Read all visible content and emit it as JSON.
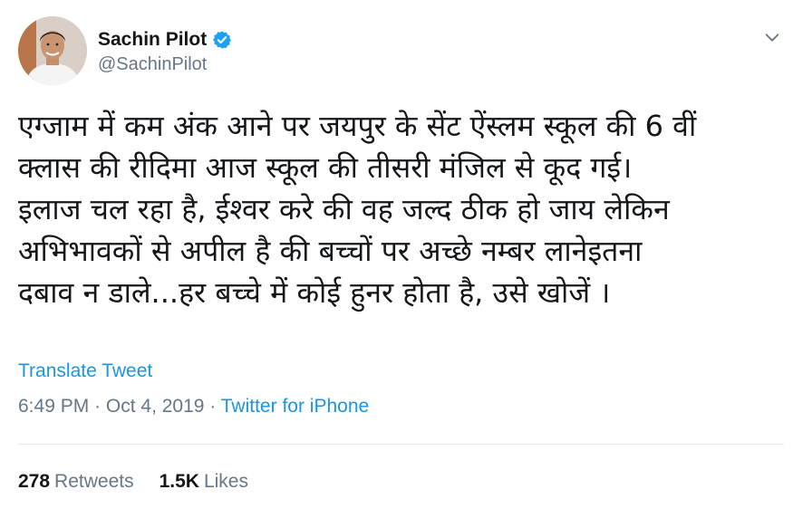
{
  "author": {
    "display_name": "Sachin Pilot",
    "handle": "@SachinPilot",
    "verified": true
  },
  "icons": {
    "verified": "verified-badge-icon",
    "menu": "chevron-down-icon"
  },
  "tweet": {
    "lines": [
      "एग्जाम में कम अंक आने पर जयपुर के सेंट ऐंस्लम स्कूल की 6 वीं",
      "क्लास की रीदिमा आज स्कूल की तीसरी मंजिल से कूद गई।",
      "इलाज चल रहा है, ईश्वर करे की वह जल्द ठीक हो जाय लेकिन",
      "अभिभावकों से अपील है की बच्चों पर अच्छे नम्बर लानेइतना",
      "दबाव न डाले...हर बच्चे में कोई हुनर होता है, उसे खोजें ।"
    ],
    "translate_label": "Translate Tweet",
    "time": "6:49 PM",
    "separator": " · ",
    "date": "Oct 4, 2019",
    "source": "Twitter for iPhone"
  },
  "stats": {
    "retweets_count": "278",
    "retweets_label": "Retweets",
    "likes_count": "1.5K",
    "likes_label": "Likes"
  },
  "colors": {
    "link": "#1b95e0",
    "secondary_text": "#657786",
    "primary_text": "#14171a",
    "divider": "#e6ecf0",
    "verified": "#1da1f2"
  }
}
